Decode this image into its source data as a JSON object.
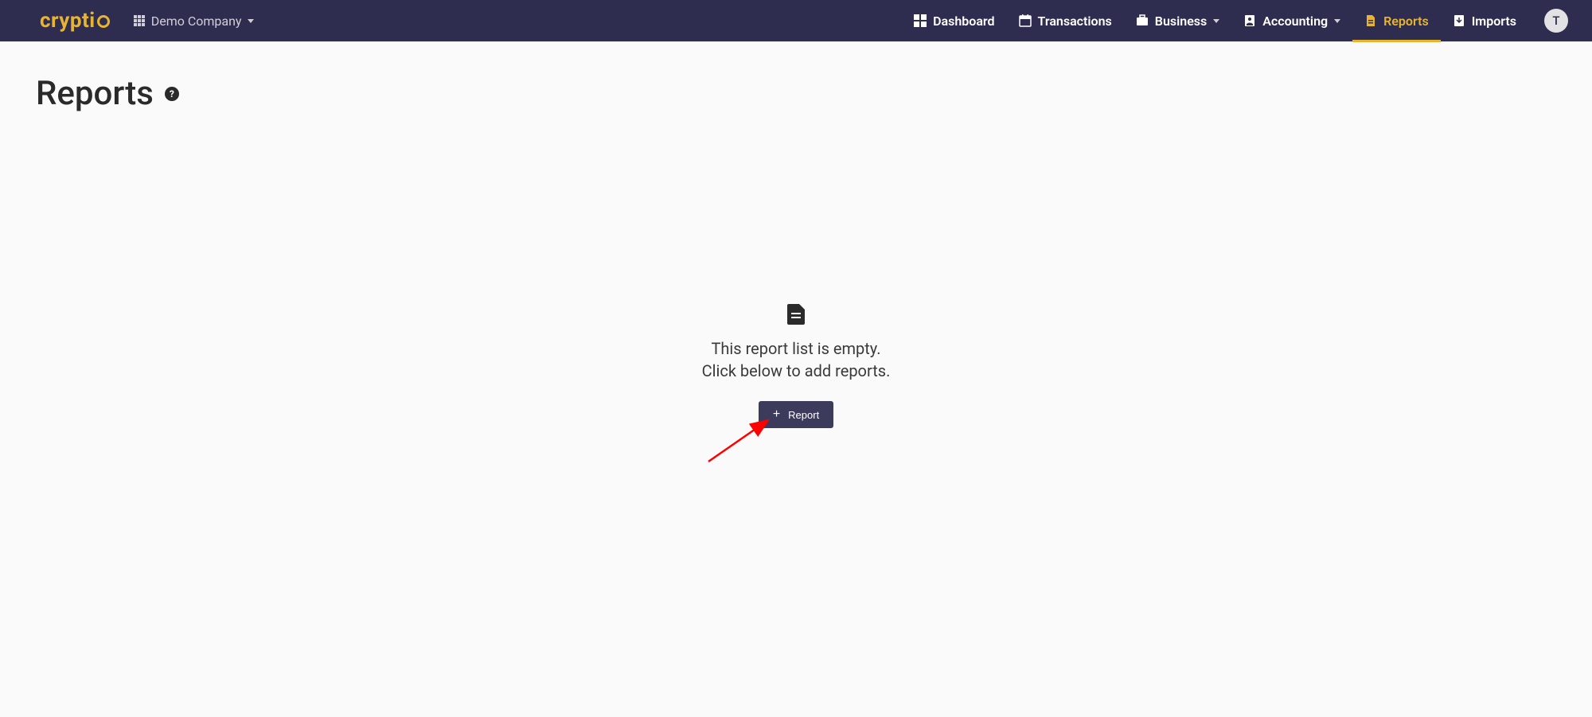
{
  "brand": {
    "name": "cryptio"
  },
  "company": {
    "name": "Demo Company"
  },
  "nav": {
    "dashboard": "Dashboard",
    "transactions": "Transactions",
    "business": "Business",
    "accounting": "Accounting",
    "reports": "Reports",
    "imports": "Imports"
  },
  "avatar": {
    "initial": "T"
  },
  "page": {
    "title": "Reports"
  },
  "empty": {
    "line1": "This report list is empty.",
    "line2": "Click below to add reports.",
    "button_label": "Report"
  }
}
